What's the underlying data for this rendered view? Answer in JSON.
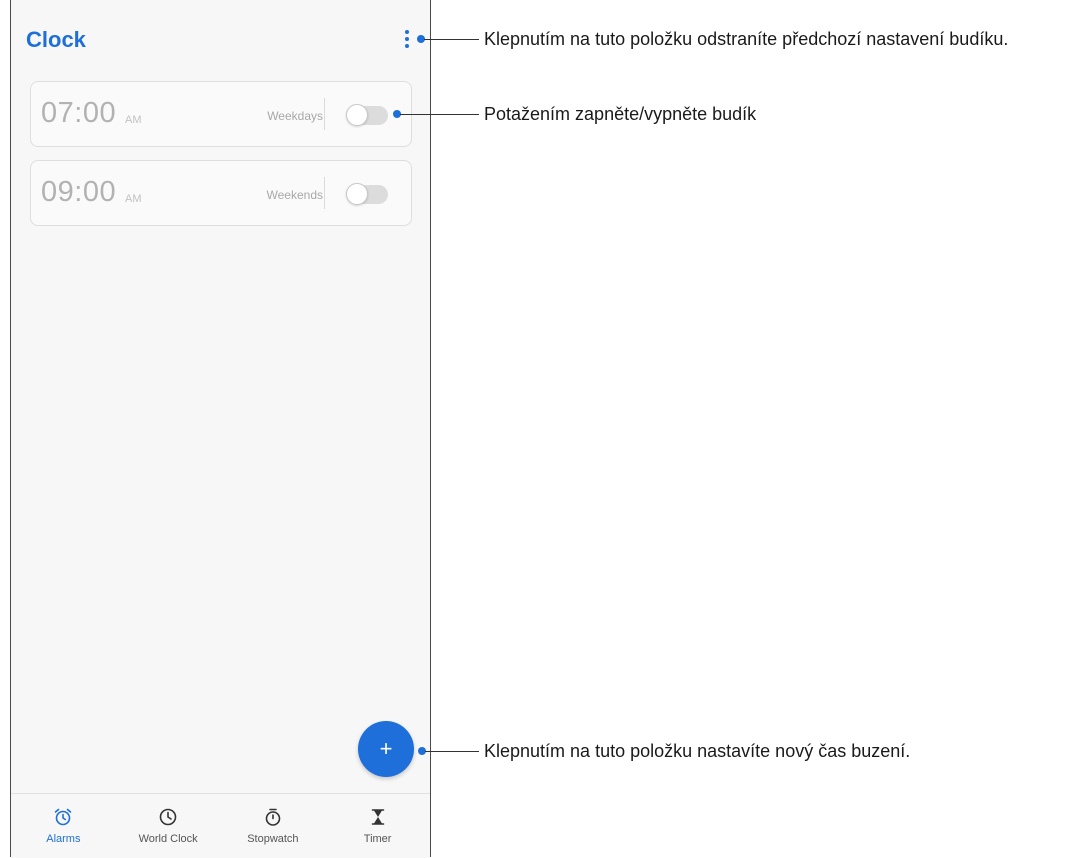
{
  "app": {
    "title": "Clock"
  },
  "alarms": [
    {
      "time": "07:00",
      "ampm": "AM",
      "repeat": "Weekdays",
      "enabled": false
    },
    {
      "time": "09:00",
      "ampm": "AM",
      "repeat": "Weekends",
      "enabled": false
    }
  ],
  "fab": {
    "label": "+"
  },
  "nav": {
    "active": "Alarms",
    "items": [
      {
        "label": "Alarms",
        "icon": "alarm-icon"
      },
      {
        "label": "World Clock",
        "icon": "clock-icon"
      },
      {
        "label": "Stopwatch",
        "icon": "stopwatch-icon"
      },
      {
        "label": "Timer",
        "icon": "hourglass-icon"
      }
    ]
  },
  "callouts": {
    "menu": "Klepnutím na tuto položku odstraníte předchozí nastavení budíku.",
    "toggle": "Potažením zapněte/vypněte budík",
    "add": "Klepnutím na tuto položku nastavíte nový čas buzení."
  },
  "colors": {
    "accent": "#1e6fd9",
    "background": "#f7f7f7"
  }
}
